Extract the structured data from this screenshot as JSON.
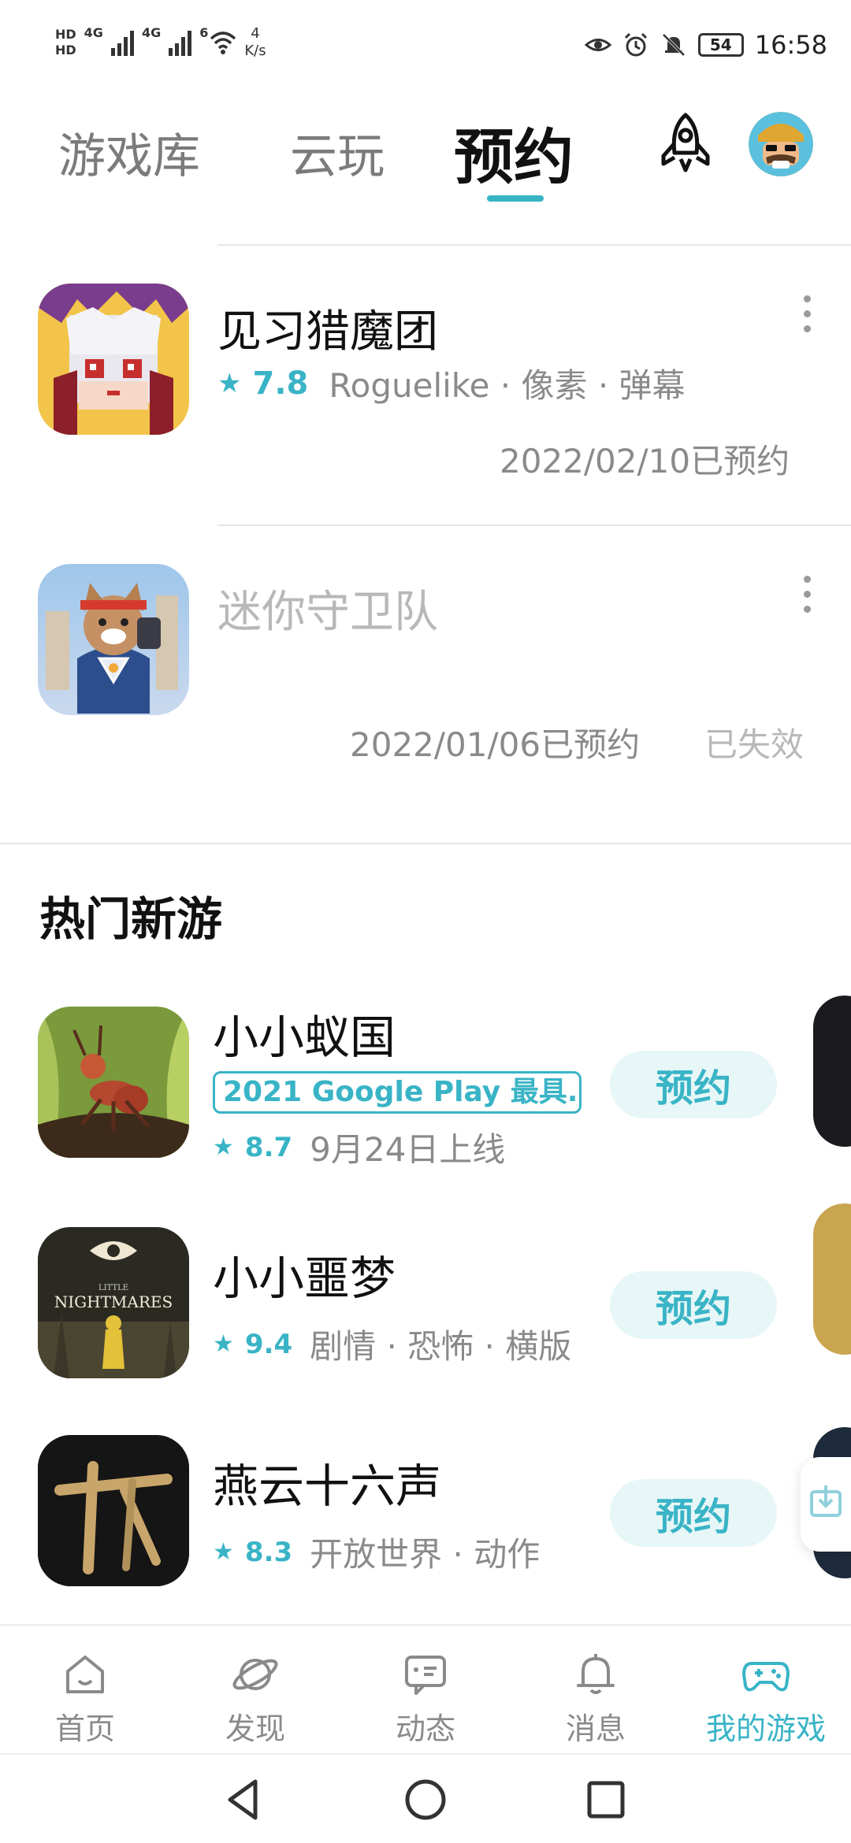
{
  "status_bar": {
    "hd1": "HD",
    "hd2": "HD",
    "net1": "4G",
    "net2": "4G",
    "wifi_badge": "6",
    "speed_value": "4",
    "speed_unit": "K/s",
    "battery": "54",
    "time": "16:58"
  },
  "header": {
    "tabs": [
      {
        "label": "游戏库"
      },
      {
        "label": "云玩"
      },
      {
        "label": "预约"
      }
    ],
    "active_tab_index": 2
  },
  "reserved": [
    {
      "name": "见习猎魔团",
      "rating": "7.8",
      "tags": "Roguelike · 像素 · 弹幕",
      "date": "2022/02/10已预约",
      "status": ""
    },
    {
      "name": "迷你守卫队",
      "rating": "",
      "tags": "",
      "date": "2022/01/06已预约",
      "status": "已失效"
    }
  ],
  "hot_section": {
    "title": "热门新游",
    "items": [
      {
        "name": "小小蚁国",
        "tag": "2021 Google Play 最具...",
        "rating": "8.7",
        "info": "9月24日上线",
        "button": "预约"
      },
      {
        "name": "小小噩梦",
        "tag": "",
        "rating": "9.4",
        "info": "剧情 · 恐怖 · 横版",
        "button": "预约"
      },
      {
        "name": "燕云十六声",
        "tag": "",
        "rating": "8.3",
        "info": "开放世界 · 动作",
        "button": "预约"
      }
    ]
  },
  "icon_text": {
    "nightmares_small": "LITTLE",
    "nightmares_big": "NIGHTMARES"
  },
  "bottom_nav": [
    {
      "label": "首页",
      "icon": "home-icon"
    },
    {
      "label": "发现",
      "icon": "planet-icon"
    },
    {
      "label": "动态",
      "icon": "chat-icon"
    },
    {
      "label": "消息",
      "icon": "bell-icon"
    },
    {
      "label": "我的游戏",
      "icon": "gamepad-icon",
      "active": true
    }
  ],
  "colors": {
    "accent": "#39b4c6",
    "button_bg": "#e7f6f7"
  }
}
